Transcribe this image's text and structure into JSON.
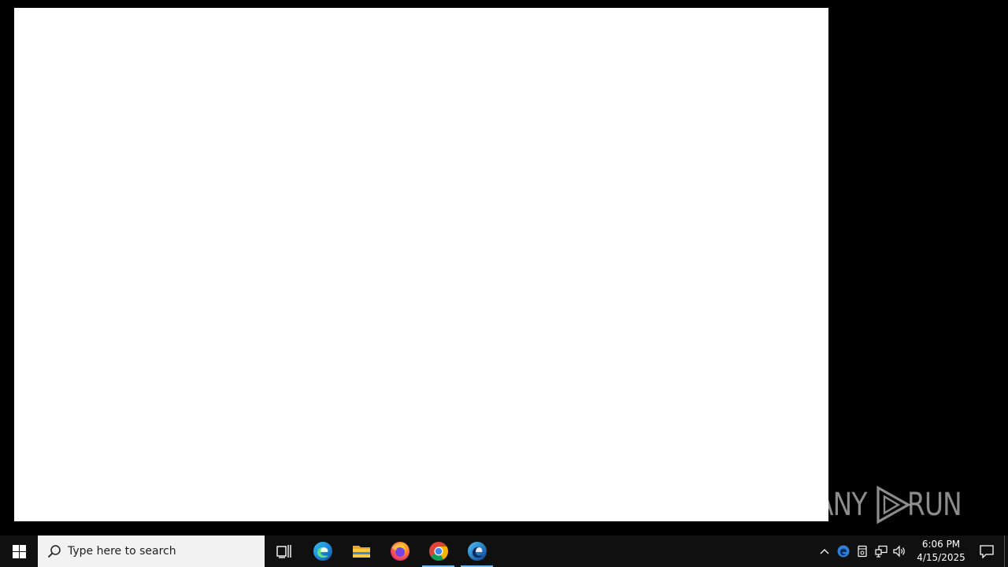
{
  "taskbar": {
    "search_placeholder": "Type here to search",
    "apps": [
      {
        "name": "task-view",
        "icon": "task-view-icon"
      },
      {
        "name": "edge",
        "icon": "edge-icon"
      },
      {
        "name": "file-explorer",
        "icon": "folder-icon"
      },
      {
        "name": "firefox",
        "icon": "firefox-icon"
      },
      {
        "name": "chrome",
        "icon": "chrome-icon",
        "running": true
      },
      {
        "name": "edge-beta",
        "icon": "edge-beta-icon",
        "running": true
      }
    ],
    "clock": {
      "time": "6:06 PM",
      "date": "4/15/2025"
    }
  },
  "watermark": {
    "left_text": "ANY",
    "right_text": "RUN"
  },
  "colors": {
    "taskbar": "#101010",
    "search_box": "#f2f2f2",
    "window": "#ffffff",
    "running_indicator": "#76b9ed"
  }
}
